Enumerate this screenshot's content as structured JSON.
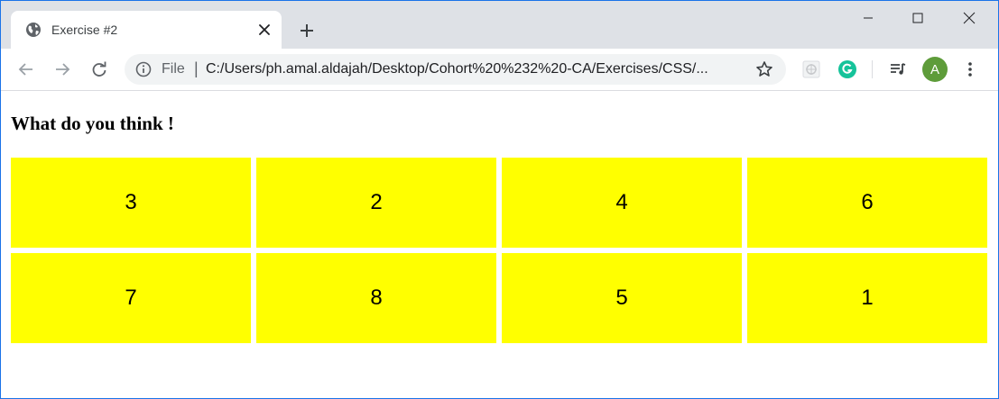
{
  "browser": {
    "tab": {
      "title": "Exercise #2",
      "favicon": "globe-icon"
    },
    "address_bar": {
      "scheme_label": "File",
      "separator": "|",
      "url": "C:/Users/ph.amal.aldajah/Desktop/Cohort%20%232%20-CA/Exercises/CSS/..."
    },
    "profile": {
      "initial": "A",
      "color": "#5e9c3a"
    },
    "icons": {
      "back": "back-arrow-icon",
      "forward": "forward-arrow-icon",
      "reload": "reload-icon",
      "info": "info-icon",
      "bookmark": "star-icon",
      "extension": "extension-icon",
      "grammarly": "grammarly-icon",
      "media": "media-queue-icon",
      "menu": "kebab-menu-icon"
    },
    "accent_color": "#1a73e8",
    "grammarly_color": "#15c39a"
  },
  "page": {
    "heading": "What do you think !",
    "cell_color": "#ffff00",
    "cells": [
      "3",
      "2",
      "4",
      "6",
      "7",
      "8",
      "5",
      "1"
    ]
  }
}
